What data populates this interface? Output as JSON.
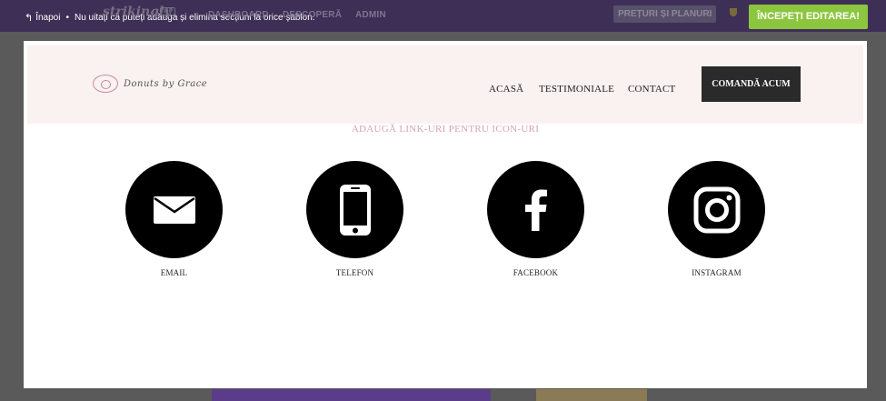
{
  "topbar": {
    "back_label": "Înapoi",
    "notice": "Nu uitați că puteți adăuga și elimina secțiuni la orice șablon.",
    "brand": "strikingly",
    "vip": "VIP",
    "nav": [
      "DASHBOARD",
      "DESCOPERĂ",
      "ADMIN"
    ],
    "pricing_label": "PREȚURI ȘI PLANURI",
    "start_label": "ÎNCEPEȚI EDITAREA!"
  },
  "site": {
    "logo_text": "Donuts by Grace",
    "menu": [
      "ACASĂ",
      "TESTIMONIALE",
      "CONTACT"
    ],
    "order_label": "COMANDĂ ACUM"
  },
  "section": {
    "hint": "ADAUGĂ LINK-URI PENTRU ICON-URI",
    "icons": [
      {
        "name": "email-icon",
        "label": "EMAIL"
      },
      {
        "name": "phone-icon",
        "label": "TELEFON"
      },
      {
        "name": "facebook-icon",
        "label": "FACEBOOK"
      },
      {
        "name": "instagram-icon",
        "label": "INSTAGRAM"
      }
    ]
  },
  "colors": {
    "topbar": "#3d2f55",
    "start_button": "#8cc63f",
    "header_bg": "#faf1f1",
    "hint_text": "#d7a3b8",
    "order_button": "#2a2a2a"
  }
}
